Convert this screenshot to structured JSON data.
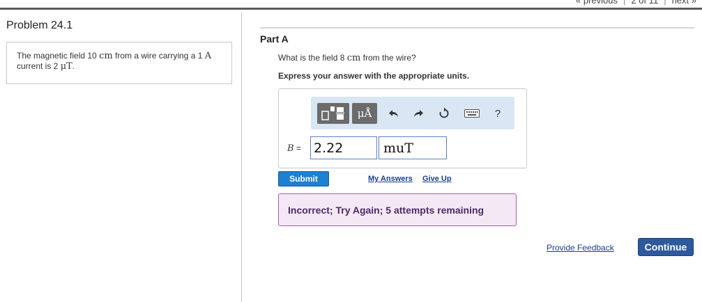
{
  "topnav": {
    "previous": "« previous",
    "position": "2 of 11",
    "next": "next »"
  },
  "problem": {
    "title": "Problem 24.1",
    "text_part1": "The magnetic field 10 ",
    "unit_cm": "cm",
    "text_part2": " from a wire carrying a 1 ",
    "unit_a": "A",
    "text_part3": " current is 2 ",
    "unit_mut": "μT",
    "text_part4": "."
  },
  "part": {
    "label": "Part A",
    "question_part1": "What is the field 8 ",
    "question_unit": "cm",
    "question_part2": " from the wire?",
    "instruction": "Express your answer with the appropriate units."
  },
  "toolbar": {
    "units_label": "μÅ",
    "help_label": "?",
    "icons": [
      "templates-icon",
      "undo-icon",
      "redo-icon",
      "reset-icon",
      "keyboard-icon",
      "help-icon"
    ]
  },
  "answer": {
    "variable": "B",
    "equals": " =",
    "value": "2.22",
    "unit": "muT"
  },
  "actions": {
    "submit": "Submit",
    "my_answers": "My Answers",
    "give_up": "Give Up"
  },
  "feedback": {
    "message": "Incorrect; Try Again; 5 attempts remaining"
  },
  "footer": {
    "provide_feedback": "Provide Feedback",
    "continue": "Continue"
  },
  "colors": {
    "submit": "#1f7fd0",
    "continue": "#2d5a9c",
    "feedback_bg": "#f4e8f4",
    "feedback_border": "#a55fa5",
    "toolbar_bg": "#d9e6f4"
  }
}
